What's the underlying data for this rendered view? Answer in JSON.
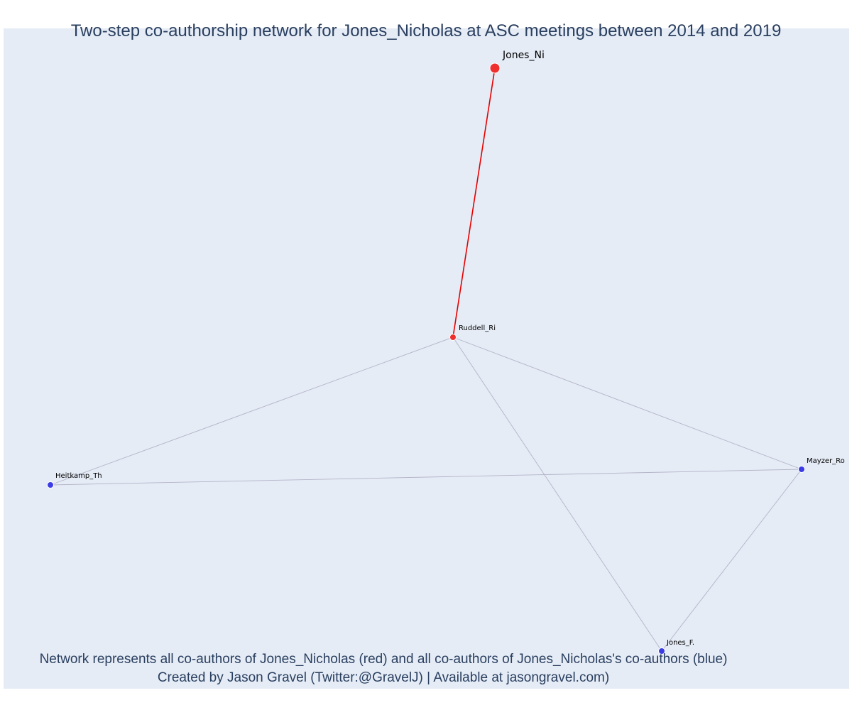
{
  "title": "Two-step co-authorship network for Jones_Nicholas at ASC meetings between 2014 and 2019",
  "caption_line1": "Network represents all co-authors of Jones_Nicholas (red) and all co-authors of Jones_Nicholas's co-authors (blue)",
  "caption_line2": "Created by Jason Gravel (Twitter:@GravelJ) | Available at jasongravel.com)",
  "colors": {
    "background": "#e5ecf6",
    "focal_node": "#ef2e2e",
    "direct_edge": "#e60000",
    "coauthor_node": "#3c3ce6",
    "other_edge": "#b4b4c8"
  },
  "nodes": [
    {
      "id": "jones_ni",
      "label": "Jones_Ni",
      "group": "focal"
    },
    {
      "id": "ruddell_ri",
      "label": "Ruddell_Ri",
      "group": "direct"
    },
    {
      "id": "heitkamp_th",
      "label": "Heitkamp_Th",
      "group": "second"
    },
    {
      "id": "mayzer_ro",
      "label": "Mayzer_Ro",
      "group": "second"
    },
    {
      "id": "jones_f",
      "label": "Jones_F.",
      "group": "second"
    }
  ],
  "edges": [
    {
      "source": "jones_ni",
      "target": "ruddell_ri",
      "type": "direct"
    },
    {
      "source": "ruddell_ri",
      "target": "heitkamp_th",
      "type": "other"
    },
    {
      "source": "ruddell_ri",
      "target": "mayzer_ro",
      "type": "other"
    },
    {
      "source": "ruddell_ri",
      "target": "jones_f",
      "type": "other"
    },
    {
      "source": "heitkamp_th",
      "target": "mayzer_ro",
      "type": "other"
    },
    {
      "source": "mayzer_ro",
      "target": "jones_f",
      "type": "other"
    }
  ]
}
